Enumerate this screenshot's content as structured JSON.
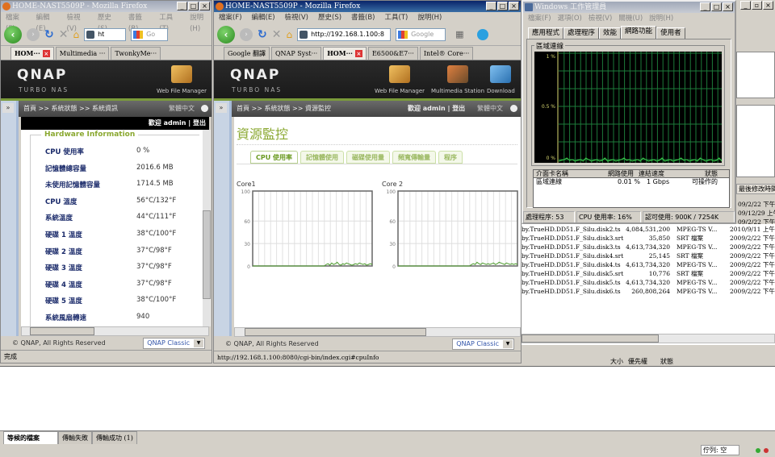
{
  "left_browser": {
    "title": "HOME-NAST5509P - Mozilla Firefox",
    "menu": [
      "檔案(F)",
      "編輯(E)",
      "檢視(V)",
      "歷史(S)",
      "書籤(B)",
      "工具(T)",
      "說明(H)"
    ],
    "url": "ht",
    "search_placeholder": "Go",
    "tabs": [
      {
        "label": "HOM···",
        "active": true
      },
      {
        "label": "Multimedia ···"
      },
      {
        "label": "TwonkyMe···"
      }
    ],
    "brand": {
      "logo": "QNAP",
      "subtitle": "TURBO NAS",
      "apps": [
        "Web File Manager"
      ]
    },
    "breadcrumb": "首頁 >> 系統狀態 >> 系統資訊",
    "language": "繁體中文",
    "welcome": "歡迎 admin",
    "logout": "登出",
    "section_title": "Hardware Information",
    "hardware": [
      {
        "label": "CPU 使用率",
        "value": "0 %"
      },
      {
        "label": "記憶體總容量",
        "value": "2016.6 MB"
      },
      {
        "label": "未使用記憶體容量",
        "value": "1714.5 MB"
      },
      {
        "label": "CPU 溫度",
        "value": "56°C/132°F"
      },
      {
        "label": "系統溫度",
        "value": "44°C/111°F"
      },
      {
        "label": "硬碟 1 溫度",
        "value": "38°C/100°F"
      },
      {
        "label": "硬碟 2 溫度",
        "value": "37°C/98°F"
      },
      {
        "label": "硬碟 3 溫度",
        "value": "37°C/98°F"
      },
      {
        "label": "硬碟 4 溫度",
        "value": "37°C/98°F"
      },
      {
        "label": "硬碟 5 溫度",
        "value": "38°C/100°F"
      },
      {
        "label": "系統風扇轉速",
        "value": "940"
      }
    ],
    "copyright": "© QNAP, All Rights Reserved",
    "skin": "QNAP Classic",
    "status": "完成"
  },
  "mid_browser": {
    "title": "HOME-NAST5509P - Mozilla Firefox",
    "menu": [
      "檔案(F)",
      "編輯(E)",
      "檢視(V)",
      "歷史(S)",
      "書籤(B)",
      "工具(T)",
      "說明(H)"
    ],
    "url": "http://192.168.1.100:8",
    "search_placeholder": "Google",
    "tabs": [
      {
        "label": "Google 翻譯"
      },
      {
        "label": "QNAP Syst···"
      },
      {
        "label": "HOM···",
        "active": true
      },
      {
        "label": "E6500&E7···"
      },
      {
        "label": "Intel® Core···"
      }
    ],
    "brand": {
      "logo": "QNAP",
      "subtitle": "TURBO NAS",
      "apps": [
        "Web File Manager",
        "Multimedia Station",
        "Download"
      ]
    },
    "breadcrumb": "首頁 >> 系統狀態 >> 資源監控",
    "welcome": "歡迎 admin",
    "logout": "登出",
    "language": "繁體中文",
    "page_title": "資源監控",
    "tabs_page": [
      "CPU 使用率",
      "記憶體使用",
      "磁碟使用量",
      "頻寬傳輸量",
      "程序"
    ],
    "charts": [
      {
        "title": "Core1",
        "yticks": [
          "100",
          "60",
          "30",
          "0"
        ],
        "values": [
          0,
          0,
          0,
          0,
          0,
          0,
          0,
          0,
          0,
          0,
          0,
          0,
          0,
          0,
          0,
          0,
          0,
          0,
          0,
          0,
          0,
          0,
          0,
          0,
          0,
          0,
          0,
          0,
          0,
          0,
          0,
          0,
          0,
          0,
          0,
          0,
          0,
          0,
          0,
          0,
          2,
          3,
          1,
          4,
          2,
          3,
          5,
          2,
          1,
          3,
          2,
          4,
          3,
          2,
          1,
          2,
          3,
          2,
          4,
          3,
          2,
          3,
          1,
          2,
          3,
          2
        ]
      },
      {
        "title": "Core 2",
        "yticks": [
          "100",
          "60",
          "30",
          "0"
        ],
        "values": [
          0,
          0,
          0,
          0,
          0,
          0,
          0,
          0,
          0,
          0,
          0,
          0,
          0,
          0,
          0,
          0,
          0,
          0,
          0,
          0,
          0,
          0,
          0,
          0,
          0,
          0,
          0,
          0,
          0,
          0,
          0,
          0,
          0,
          0,
          0,
          0,
          0,
          0,
          0,
          0,
          2,
          3,
          2,
          5,
          3,
          2,
          4,
          3,
          2,
          3,
          2,
          3,
          4,
          2,
          3,
          5,
          4,
          3,
          2,
          4,
          3,
          2,
          3,
          2,
          3,
          2
        ]
      }
    ],
    "copyright": "© QNAP, All Rights Reserved",
    "skin": "QNAP Classic",
    "status": "http://192.168.1.100:8080/cgi-bin/index.cgi#cpuInfo"
  },
  "task_manager": {
    "title": "Windows 工作管理員",
    "menu": [
      "檔案(F)",
      "選項(O)",
      "檢視(V)",
      "關機(U)",
      "說明(H)"
    ],
    "tabs": [
      "應用程式",
      "處理程序",
      "效能",
      "網路功能",
      "使用者"
    ],
    "active_tab": "網路功能",
    "group_title": "區域連線",
    "graph_labels": [
      "1 %",
      "0.5 %",
      "0 %"
    ],
    "columns": [
      "介面卡名稱",
      "網路使用",
      "連結速度",
      "狀態"
    ],
    "rows": [
      {
        "name": "區域連線",
        "usage": "0.01 %",
        "speed": "1 Gbps",
        "state": "可操作的"
      }
    ],
    "status": {
      "processes": "處理程序: 53",
      "cpu": "CPU 使用率: 16%",
      "commit": "認可使用: 900K / 7254K"
    }
  },
  "file_list": {
    "header_fragment": "最後修改時間",
    "rows": [
      {
        "name": "by.TrueHD.DD51.F_Silu.disk2.ts",
        "size": "4,084,531,200",
        "type": "MPEG-TS V...",
        "date": "2010/9/11 上午"
      },
      {
        "name": "by.TrueHD.DD51.F_Silu.disk3.srt",
        "size": "35,850",
        "type": "SRT 檔案",
        "date": "2009/2/22 下午"
      },
      {
        "name": "by.TrueHD.DD51.F_Silu.disk3.ts",
        "size": "4,613,734,320",
        "type": "MPEG-TS V...",
        "date": "2009/2/22 下午"
      },
      {
        "name": "by.TrueHD.DD51.F_Silu.disk4.srt",
        "size": "25,145",
        "type": "SRT 檔案",
        "date": "2009/2/22 下午"
      },
      {
        "name": "by.TrueHD.DD51.F_Silu.disk4.ts",
        "size": "4,613,734,320",
        "type": "MPEG-TS V...",
        "date": "2009/2/22 下午"
      },
      {
        "name": "by.TrueHD.DD51.F_Silu.disk5.srt",
        "size": "10,776",
        "type": "SRT 檔案",
        "date": "2009/2/22 下午"
      },
      {
        "name": "by.TrueHD.DD51.F_Silu.disk5.ts",
        "size": "4,613,734,320",
        "type": "MPEG-TS V...",
        "date": "2009/2/22 下午"
      },
      {
        "name": "by.TrueHD.DD51.F_Silu.disk6.ts",
        "size": "260,808,264",
        "type": "MPEG-TS V...",
        "date": "2009/2/22 下午"
      }
    ],
    "partial_dates": [
      "09/2/22 下午",
      "09/12/29 上午",
      "09/2/22 下午"
    ]
  },
  "queue": {
    "columns": [
      "大小",
      "優先權",
      "狀態"
    ],
    "tabs": [
      "等候的檔案",
      "傳輸失敗",
      "傳輸成功 (1)"
    ],
    "status": "佇列: 空"
  }
}
